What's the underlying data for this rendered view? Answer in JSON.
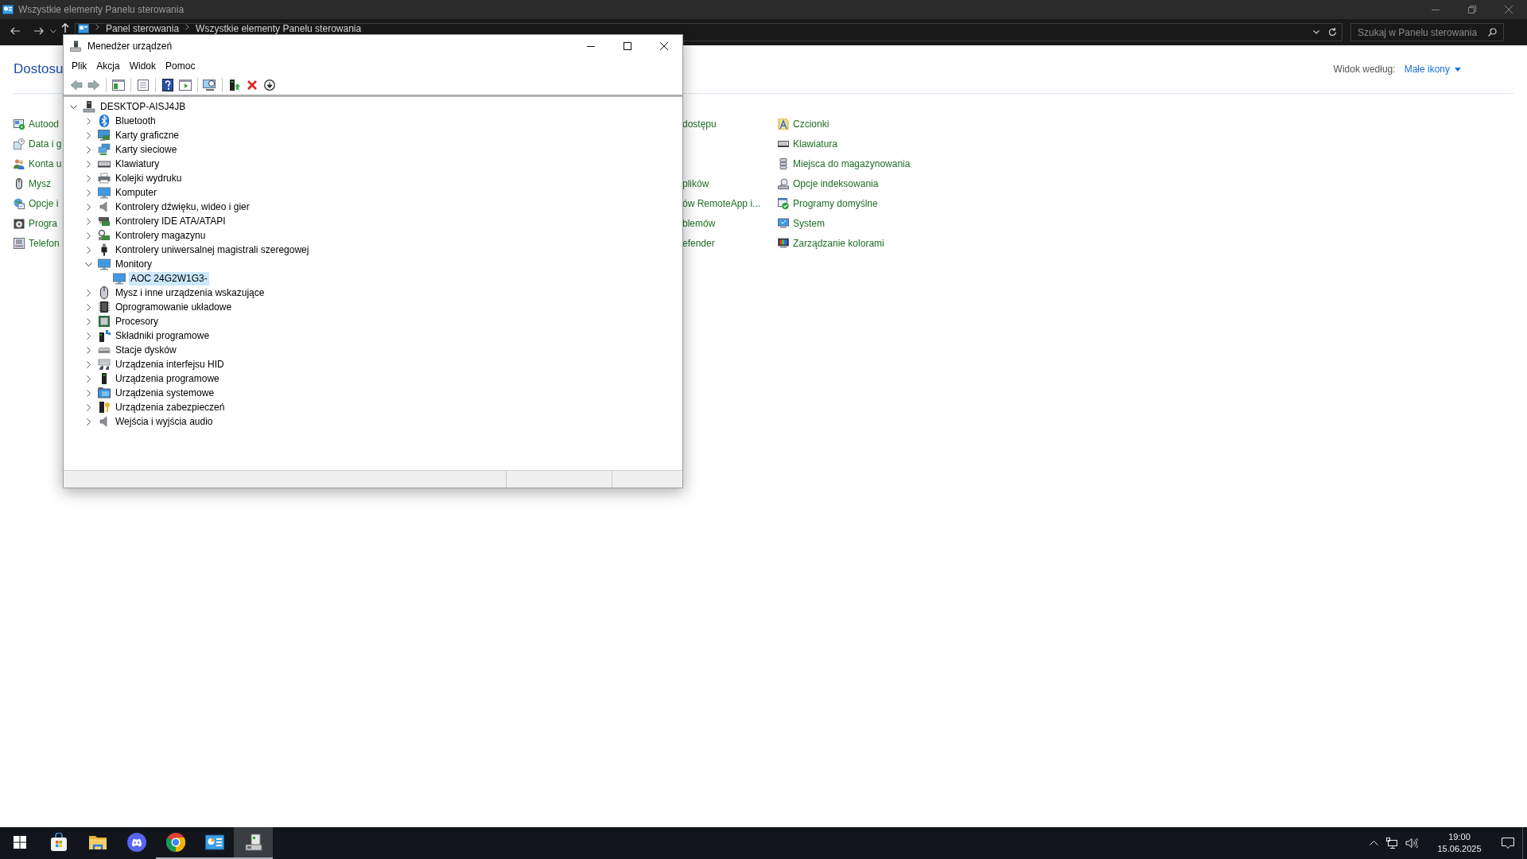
{
  "explorer": {
    "title": "Wszystkie elementy Panelu sterowania",
    "breadcrumbs": [
      "Panel sterowania",
      "Wszystkie elementy Panelu sterowania"
    ],
    "search": {
      "placeholder": "Szukaj w Panelu sterowania"
    },
    "heading": "Dostosu",
    "view_by": {
      "label": "Widok według:",
      "value": "Małe ikony"
    },
    "column_1": [
      "Autood",
      "Data i g",
      "Konta u",
      "Mysz",
      "Opcje i",
      "Progra",
      "Telefon"
    ],
    "column_2": [
      [
        "dostępu"
      ],
      [
        "plików",
        "ów RemoteApp i...",
        "blemów",
        "efender"
      ]
    ],
    "column_3": [
      "Czcionki",
      "Klawiatura",
      "Miejsca do magazynowania",
      "Opcje indeksowania",
      "Programy domyślne",
      "System",
      "Zarządzanie kolorami"
    ]
  },
  "device_manager": {
    "title": "Menedżer urządzeń",
    "menu": [
      "Plik",
      "Akcja",
      "Widok",
      "Pomoc"
    ],
    "tree": {
      "label": "DESKTOP-AISJ4JB",
      "expanded": true,
      "selected": false,
      "children": [
        {
          "label": "Bluetooth",
          "expanded": false,
          "selected": false
        },
        {
          "label": "Karty graficzne",
          "expanded": false,
          "selected": false
        },
        {
          "label": "Karty sieciowe",
          "expanded": false,
          "selected": false
        },
        {
          "label": "Klawiatury",
          "expanded": false,
          "selected": false
        },
        {
          "label": "Kolejki wydruku",
          "expanded": false,
          "selected": false
        },
        {
          "label": "Komputer",
          "expanded": false,
          "selected": false
        },
        {
          "label": "Kontrolery dźwięku, wideo i gier",
          "expanded": false,
          "selected": false
        },
        {
          "label": "Kontrolery IDE ATA/ATAPI",
          "expanded": false,
          "selected": false
        },
        {
          "label": "Kontrolery magazynu",
          "expanded": false,
          "selected": false
        },
        {
          "label": "Kontrolery uniwersalnej magistrali szeregowej",
          "expanded": false,
          "selected": false
        },
        {
          "label": "Monitory",
          "expanded": true,
          "selected": false,
          "children": [
            {
              "label": "AOC 24G2W1G3-",
              "selected": true
            }
          ]
        },
        {
          "label": "Mysz i inne urządzenia wskazujące",
          "expanded": false,
          "selected": false
        },
        {
          "label": "Oprogramowanie układowe",
          "expanded": false,
          "selected": false
        },
        {
          "label": "Procesory",
          "expanded": false,
          "selected": false
        },
        {
          "label": "Składniki programowe",
          "expanded": false,
          "selected": false
        },
        {
          "label": "Stacje dysków",
          "expanded": false,
          "selected": false
        },
        {
          "label": "Urządzenia interfejsu HID",
          "expanded": false,
          "selected": false
        },
        {
          "label": "Urządzenia programowe",
          "expanded": false,
          "selected": false
        },
        {
          "label": "Urządzenia systemowe",
          "expanded": false,
          "selected": false
        },
        {
          "label": "Urządzenia zabezpieczeń",
          "expanded": false,
          "selected": false
        },
        {
          "label": "Wejścia i wyjścia audio",
          "expanded": false,
          "selected": false
        }
      ]
    }
  },
  "taskbar": {
    "apps": [
      {
        "kind": "start",
        "running": false,
        "active": false
      },
      {
        "kind": "store",
        "running": false,
        "active": false
      },
      {
        "kind": "files",
        "running": false,
        "active": false
      },
      {
        "kind": "chat",
        "running": false,
        "active": false
      },
      {
        "kind": "browser",
        "running": true,
        "active": false
      },
      {
        "kind": "control-panel",
        "running": true,
        "active": false
      },
      {
        "kind": "device-manager",
        "running": true,
        "active": true
      }
    ],
    "clock": {
      "time": "19:00",
      "date": "15.06.2025"
    }
  }
}
